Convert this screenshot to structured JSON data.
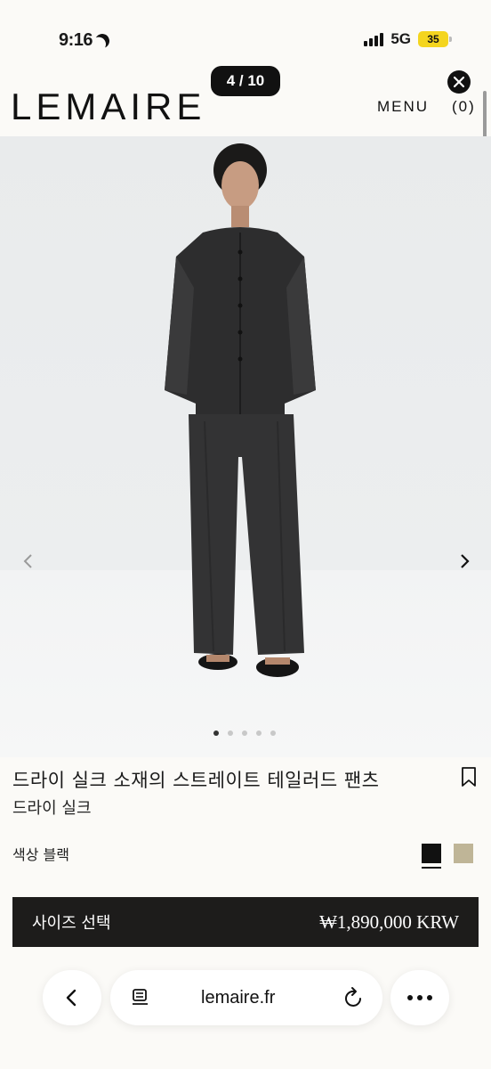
{
  "status_bar": {
    "time": "9:16",
    "network": "5G",
    "battery": "35"
  },
  "header": {
    "logo": "LEMAIRE",
    "image_counter": "4 / 10",
    "menu_label": "MENU",
    "cart_label": "(0)"
  },
  "gallery": {
    "dot_count": 5,
    "active_index": 0
  },
  "product": {
    "title": "드라이 실크 소재의 스트레이트 테일러드 팬츠",
    "subtitle": "드라이 실크",
    "color_label": "색상 블랙",
    "swatches": [
      {
        "name": "black",
        "color": "#111111",
        "selected": true
      },
      {
        "name": "beige",
        "color": "#bfb597",
        "selected": false
      }
    ],
    "size_select_label": "사이즈 선택",
    "price": "₩1,890,000 KRW"
  },
  "browser": {
    "url": "lemaire.fr"
  },
  "icons": {
    "close": "close-icon",
    "prev": "chevron-left-icon",
    "next": "chevron-right-icon",
    "bookmark": "bookmark-icon",
    "back": "back-arrow-icon",
    "reader": "reader-mode-icon",
    "reload": "reload-icon",
    "more": "more-icon"
  }
}
